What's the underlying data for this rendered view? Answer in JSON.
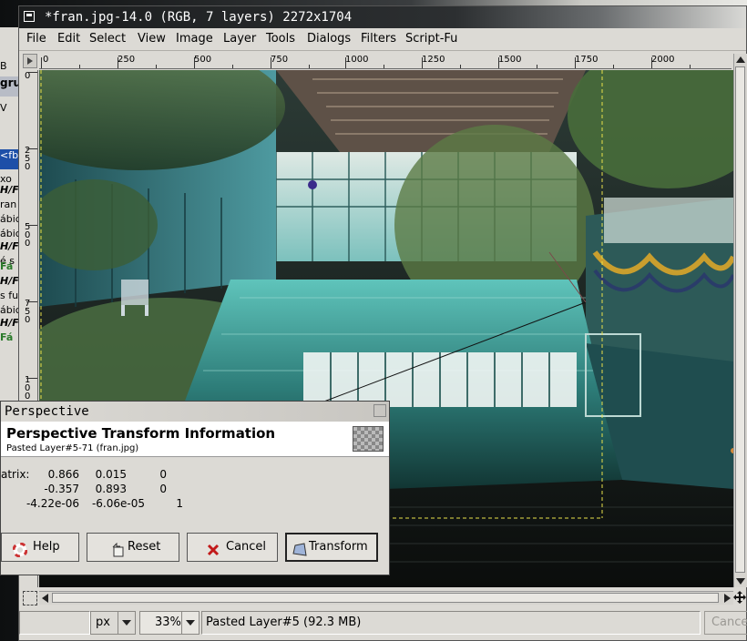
{
  "window": {
    "title": "*fran.jpg-14.0 (RGB, 7 layers) 2272x1704"
  },
  "menubar": {
    "items": [
      "File",
      "Edit",
      "Select",
      "View",
      "Image",
      "Layer",
      "Tools",
      "Dialogs",
      "Filters",
      "Script-Fu"
    ]
  },
  "rulers": {
    "horizontal": [
      "0",
      "250",
      "500",
      "750",
      "1000",
      "1250",
      "1500",
      "1750",
      "2000"
    ],
    "vertical": [
      "0",
      "2\n5\n0",
      "5\n0\n0",
      "7\n5\n0",
      "1\n0\n0"
    ]
  },
  "background_window": {
    "fragments": [
      "B",
      "gru",
      "V",
      "<fb",
      "xo",
      "H/F",
      "ran",
      "ábic",
      "ábic",
      "H/F",
      "é s",
      "Fá",
      "H/F",
      "s fu",
      "ábic",
      "H/F",
      "Fá"
    ]
  },
  "dialog": {
    "title": "Perspective",
    "heading": "Perspective Transform Information",
    "subheading": "Pasted Layer#5-71 (fran.jpg)",
    "matrix_label": "atrix:",
    "matrix": [
      [
        "0.866",
        "0.015",
        "0"
      ],
      [
        "-0.357",
        "0.893",
        "0"
      ],
      [
        "-4.22e-06",
        "-6.06e-05",
        "1"
      ]
    ],
    "buttons": {
      "help": "Help",
      "reset": "Reset",
      "cancel": "Cancel",
      "transform": "Transform"
    }
  },
  "statusbar": {
    "unit": "px",
    "zoom": "33%",
    "message": "Pasted Layer#5 (92.3 MB)",
    "cancel": "Cancel"
  },
  "colors": {
    "titlebar_dark": "#1b1d1e",
    "window_bg": "#dcdad5",
    "selection_blue": "#1d4fa8",
    "pool_teal": "#3fa7a0"
  },
  "icons": [
    "window-menu-icon",
    "navigate-icon",
    "quickmask-icon",
    "help-icon",
    "reset-icon",
    "cancel-icon",
    "transform-icon",
    "close-icon"
  ]
}
